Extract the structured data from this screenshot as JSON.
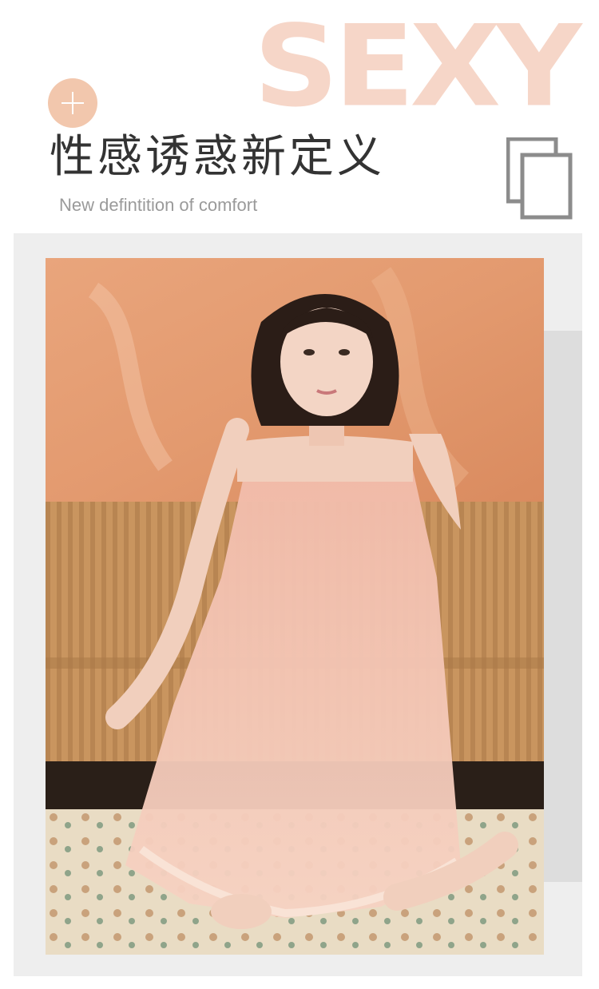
{
  "header": {
    "deco_word": "SEXY",
    "badge_icon": "plus-icon",
    "headline": "性感诱惑新定义",
    "subline": "New defintition of comfort",
    "corner_icon": "copy-icon"
  },
  "photo": {
    "subject": "product-photo",
    "colors": {
      "wall": "#e39a6f",
      "sofa": "#c9955f",
      "dress": "#f0b7a6",
      "accent": "#f2c7ad",
      "rug": "#e9dcc4"
    }
  }
}
